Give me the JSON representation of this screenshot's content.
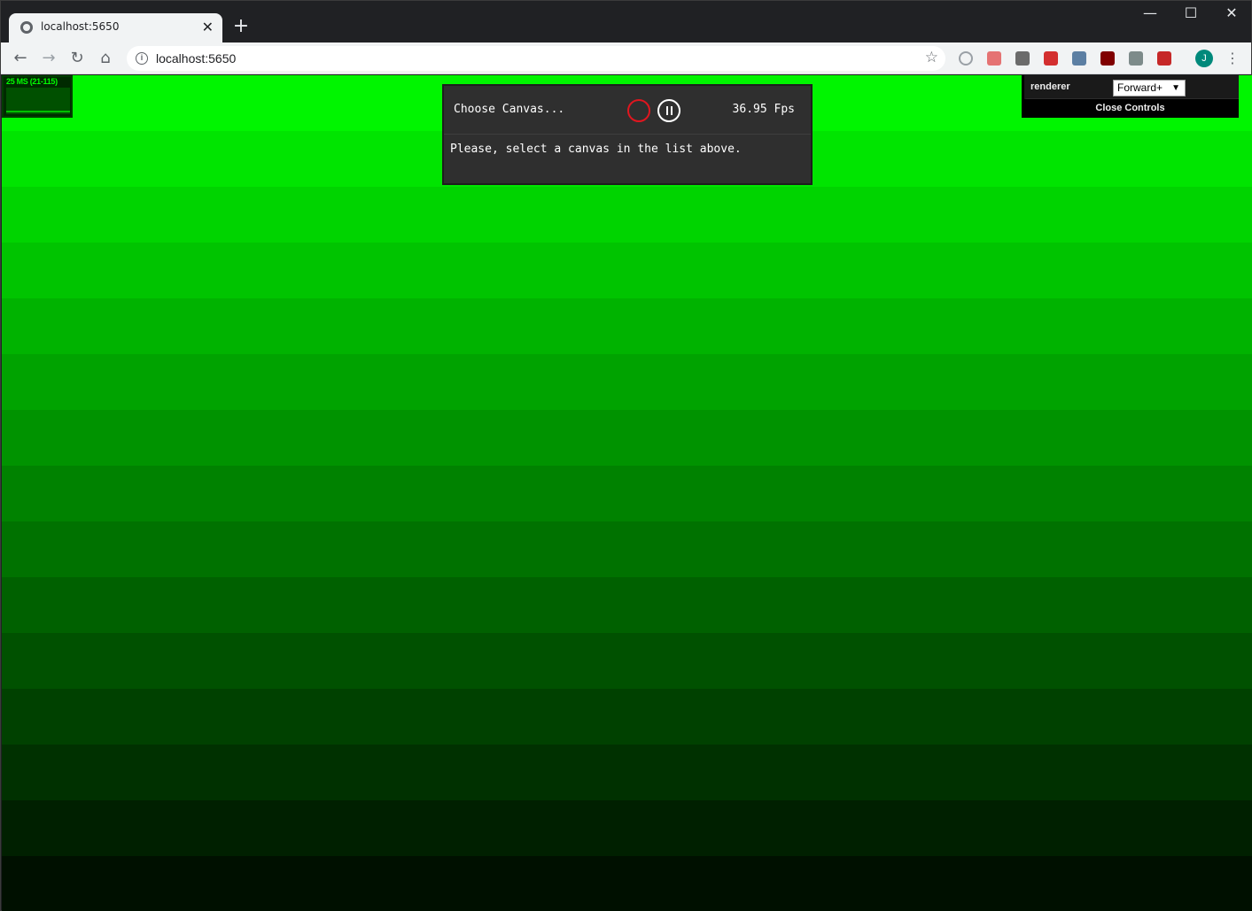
{
  "browser": {
    "tab_title": "localhost:5650",
    "tab_close": "✕",
    "new_tab": "+",
    "url": "localhost:5650",
    "avatar_initial": "J",
    "window_controls": {
      "minimize": "—",
      "maximize": "☐",
      "close": "✕"
    },
    "nav": {
      "back": "←",
      "forward": "→",
      "reload": "↻",
      "home": "⌂",
      "star": "☆",
      "menu": "⋮",
      "info": "i"
    },
    "extensions": [
      {
        "name": "extension-circle-icon",
        "color": "#9aa0a6"
      },
      {
        "name": "extension-red-icon",
        "color": "#e57373"
      },
      {
        "name": "extension-drive-icon",
        "color": "#6b6b6b"
      },
      {
        "name": "extension-lastpass-icon",
        "color": "#d32f2f"
      },
      {
        "name": "extension-glasses-icon",
        "color": "#5c7fa3"
      },
      {
        "name": "extension-ublock-icon",
        "color": "#800000"
      },
      {
        "name": "extension-grey-icon",
        "color": "#7d8b8a"
      },
      {
        "name": "extension-spector-icon",
        "color": "#c62828"
      }
    ]
  },
  "stats": {
    "label": "25 MS (21-115)"
  },
  "spector": {
    "choose_canvas": "Choose Canvas...",
    "fps": "36.95 Fps",
    "message": "Please, select a canvas in the list above."
  },
  "controls": {
    "renderer_label": "renderer",
    "renderer_value": "Forward+",
    "renderer_arrow": "▼",
    "close_label": "Close Controls"
  },
  "scene": {
    "band_colors": [
      "#00f500",
      "#00e500",
      "#00d400",
      "#00c400",
      "#00b300",
      "#00a300",
      "#009300",
      "#008200",
      "#007200",
      "#006100",
      "#005100",
      "#004100",
      "#003100",
      "#002000",
      "#001000",
      "#000000"
    ]
  }
}
